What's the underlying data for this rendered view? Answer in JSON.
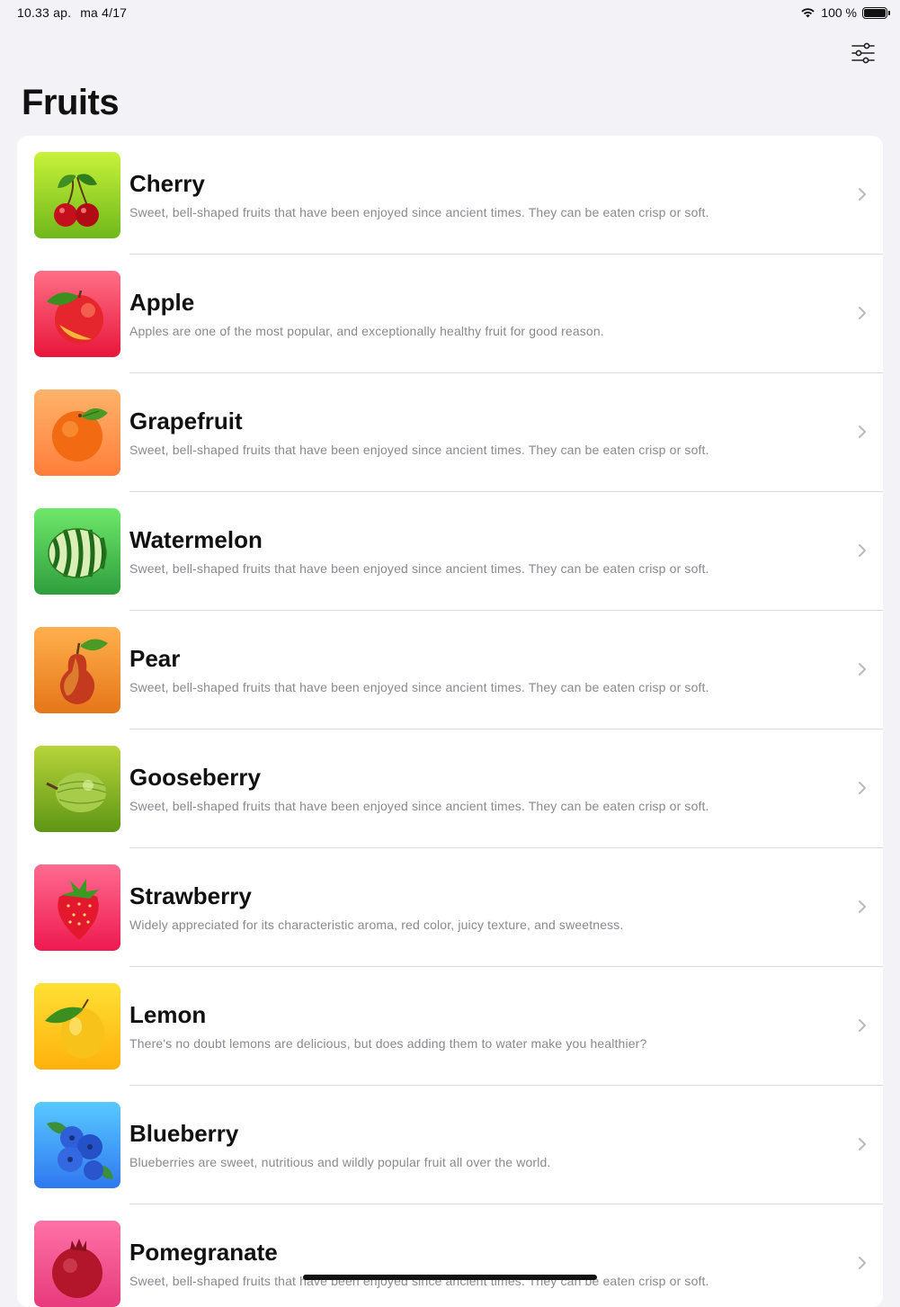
{
  "status_bar": {
    "time": "10.33 ap.",
    "date": "ma 4/17",
    "battery": "100 %"
  },
  "header": {
    "title": "Fruits",
    "filter_icon": "sliders-icon"
  },
  "fruits": [
    {
      "name": "Cherry",
      "description": "Sweet, bell-shaped fruits that have been enjoyed since ancient times. They can be eaten crisp or soft.",
      "gradient": [
        "#c8f23a",
        "#6fb81a"
      ]
    },
    {
      "name": "Apple",
      "description": "Apples are one of the most popular, and exceptionally healthy fruit for good reason.",
      "gradient": [
        "#ff6f87",
        "#e8163a"
      ]
    },
    {
      "name": "Grapefruit",
      "description": "Sweet, bell-shaped fruits that have been enjoyed since ancient times. They can be eaten crisp or soft.",
      "gradient": [
        "#ffb36b",
        "#ff7e3a"
      ]
    },
    {
      "name": "Watermelon",
      "description": "Sweet, bell-shaped fruits that have been enjoyed since ancient times. They can be eaten crisp or soft.",
      "gradient": [
        "#6ee86a",
        "#2f9e3d"
      ]
    },
    {
      "name": "Pear",
      "description": "Sweet, bell-shaped fruits that have been enjoyed since ancient times. They can be eaten crisp or soft.",
      "gradient": [
        "#ffb04d",
        "#e57618"
      ]
    },
    {
      "name": "Gooseberry",
      "description": "Sweet, bell-shaped fruits that have been enjoyed since ancient times. They can be eaten crisp or soft.",
      "gradient": [
        "#b8d43a",
        "#5e9615"
      ]
    },
    {
      "name": "Strawberry",
      "description": "Widely appreciated for its characteristic aroma,  red color, juicy texture, and sweetness.",
      "gradient": [
        "#ff6b8f",
        "#ee1950"
      ]
    },
    {
      "name": "Lemon",
      "description": "There's no doubt lemons are delicious, but does adding them to water make you healthier?",
      "gradient": [
        "#ffe034",
        "#ffb10c"
      ]
    },
    {
      "name": "Blueberry",
      "description": "Blueberries are sweet, nutritious and wildly popular fruit all over the world.",
      "gradient": [
        "#58c9ff",
        "#2f78f0"
      ]
    },
    {
      "name": "Pomegranate",
      "description": "Sweet, bell-shaped fruits that have been enjoyed since ancient times. They can be eaten crisp or soft.",
      "gradient": [
        "#ff72a6",
        "#e63a7c"
      ]
    }
  ]
}
